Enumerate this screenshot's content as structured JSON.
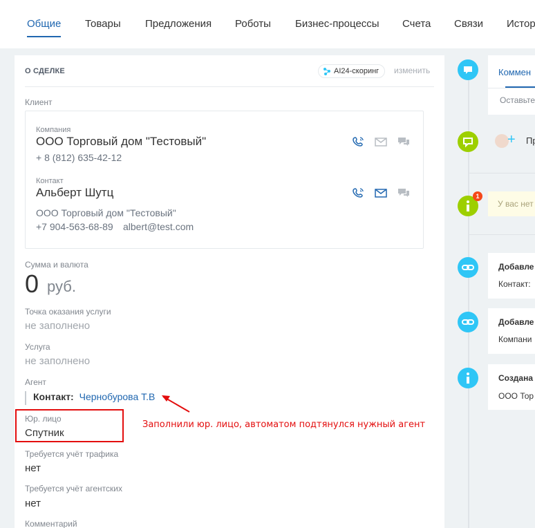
{
  "tabs": [
    "Общие",
    "Товары",
    "Предложения",
    "Роботы",
    "Бизнес-процессы",
    "Счета",
    "Связи",
    "Истор"
  ],
  "card": {
    "title": "О СДЕЛКЕ",
    "ai_badge": "AI24-скоринг",
    "edit": "изменить"
  },
  "client": {
    "label": "Клиент",
    "company_label": "Компания",
    "company_name": "ООО Торговый дом \"Тестовый\"",
    "company_phone": "+ 8 (812) 635-42-12",
    "contact_label": "Контакт",
    "contact_name": "Альберт Шутц",
    "contact_company": "ООО Торговый дом \"Тестовый\"",
    "contact_phone": "+7 904-563-68-89",
    "contact_email": "albert@test.com"
  },
  "fields": {
    "amount_label": "Сумма и валюта",
    "amount": "0",
    "currency": "руб.",
    "service_point_label": "Точка оказания услуги",
    "service_point_value": "не заполнено",
    "service_label": "Услуга",
    "service_value": "не заполнено",
    "agent_label": "Агент",
    "agent_prefix": "Контакт:",
    "agent_name": "Чернобурова Т.В",
    "legal_label": "Юр. лицо",
    "legal_value": "Спутник",
    "traffic_label": "Требуется учёт трафика",
    "traffic_value": "нет",
    "agency_label": "Требуется учёт агентских",
    "agency_value": "нет",
    "comment_label": "Комментарий"
  },
  "annotation": "Заполнили юр. лицо, автоматом подтянулся нужный агент",
  "timeline": {
    "comment_tab": "Коммен",
    "comment_placeholder": "Оставьте",
    "activity_text": "Пр",
    "notice_badge": "1",
    "notice_text": "У вас нет",
    "event1_title": "Добавле",
    "event1_text": "Контакт:",
    "event2_title": "Добавле",
    "event2_text": "Компани",
    "event3_title": "Создана",
    "event3_text": "ООО Тор"
  },
  "colors": {
    "accent": "#2067b0",
    "timeline_blue": "#2fc6f6",
    "timeline_green": "#9dcf00",
    "annotation_red": "#e30d0d"
  }
}
